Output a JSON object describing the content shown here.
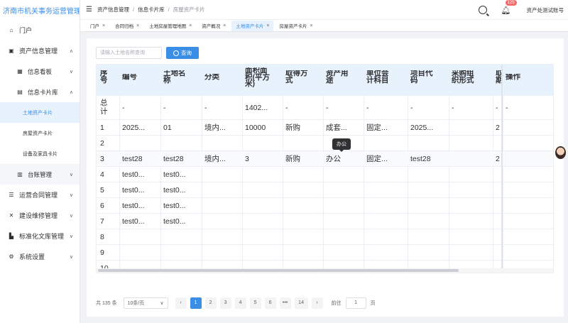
{
  "app": {
    "title": "济南市机关事务运营管理系统"
  },
  "sidebar": {
    "items": [
      {
        "label": "门户",
        "icon": "home-icon"
      },
      {
        "label": "资产信息管理",
        "icon": "asset-icon",
        "expanded": true
      },
      {
        "label": "信息看板",
        "icon": "dashboard-icon"
      },
      {
        "label": "信息卡片库",
        "icon": "card-library-icon",
        "expanded": true
      },
      {
        "label": "土地资产卡片",
        "active": true
      },
      {
        "label": "房屋资产卡片"
      },
      {
        "label": "设备及家具卡片"
      },
      {
        "label": "台账管理",
        "icon": "ledger-icon"
      },
      {
        "label": "运营合同管理",
        "icon": "contract-icon"
      },
      {
        "label": "建设维修管理",
        "icon": "wrench-icon"
      },
      {
        "label": "标准化文库管理",
        "icon": "library-icon"
      },
      {
        "label": "系统设置",
        "icon": "settings-icon"
      }
    ]
  },
  "header": {
    "breadcrumbs": [
      "资产信息管理",
      "信息卡片库",
      "房屋资产卡片"
    ],
    "notification_count": "125",
    "account": "资产处测试账号"
  },
  "tabs": [
    {
      "label": "门户",
      "active": false
    },
    {
      "label": "合同归档",
      "active": false
    },
    {
      "label": "土地房屋管理地图",
      "active": false
    },
    {
      "label": "资产概况",
      "active": false
    },
    {
      "label": "土地资产卡片",
      "active": true
    },
    {
      "label": "房屋资产卡片",
      "active": false
    }
  ],
  "search": {
    "placeholder": "请输入土地名称查询",
    "value": "",
    "button_label": "查询"
  },
  "table": {
    "headers": [
      "序号",
      "编号",
      "土地名称",
      "分类",
      "面积(平方米)",
      "取得方式",
      "资产用途",
      "单位会计科目",
      "项目代码",
      "采购组织形式",
      "取得",
      "操作"
    ],
    "header_lines": [
      [
        "序",
        "号"
      ],
      [
        "编号"
      ],
      [
        "土地名",
        "称"
      ],
      [
        "分类"
      ],
      [
        "面积面",
        "积(平方",
        "米)"
      ],
      [
        "取得方",
        "式"
      ],
      [
        "资产用",
        "途"
      ],
      [
        "单位会",
        "计科目"
      ],
      [
        "项目代",
        "码"
      ],
      [
        "采购组",
        "织形式"
      ],
      [
        "取",
        "期"
      ],
      [
        "操作"
      ]
    ],
    "total_row": [
      "总计",
      "-",
      "-",
      "-",
      "1402...",
      "-",
      "-",
      "-",
      "-",
      "-",
      "-",
      "-"
    ],
    "rows": [
      [
        "1",
        "2025...",
        "01",
        "境内...",
        "10000",
        "新购",
        "成套...",
        "固定...",
        "2025...",
        "",
        "2",
        ""
      ],
      [
        "2",
        "",
        "",
        "",
        "",
        "",
        "",
        "",
        "",
        "",
        "",
        ""
      ],
      [
        "3",
        "test28",
        "test28",
        "境内...",
        "3",
        "新购",
        "办公",
        "固定...",
        "test28",
        "",
        "2",
        ""
      ],
      [
        "4",
        "test0...",
        "test0...",
        "",
        "",
        "",
        "",
        "",
        "",
        "",
        "",
        ""
      ],
      [
        "5",
        "test0...",
        "test0...",
        "",
        "",
        "",
        "",
        "",
        "",
        "",
        "",
        ""
      ],
      [
        "6",
        "test0...",
        "test0...",
        "",
        "",
        "",
        "",
        "",
        "",
        "",
        "",
        ""
      ],
      [
        "7",
        "test0...",
        "test0...",
        "",
        "",
        "",
        "",
        "",
        "",
        "",
        "",
        ""
      ],
      [
        "8",
        "",
        "",
        "",
        "",
        "",
        "",
        "",
        "",
        "",
        "",
        ""
      ],
      [
        "9",
        "",
        "",
        "",
        "",
        "",
        "",
        "",
        "",
        "",
        "",
        ""
      ],
      [
        "10",
        "",
        "",
        "",
        "",
        "",
        "",
        "",
        "",
        "",
        "",
        ""
      ]
    ],
    "tooltip": "办公"
  },
  "pagination": {
    "total": "共 135 条",
    "page_size": "10条/页",
    "prev": "‹",
    "pages": [
      "1",
      "2",
      "3",
      "4",
      "5",
      "6",
      "•••",
      "14"
    ],
    "next": "›",
    "current": "1",
    "goto_label": "前往",
    "goto_value": "1",
    "goto_suffix": "页"
  }
}
